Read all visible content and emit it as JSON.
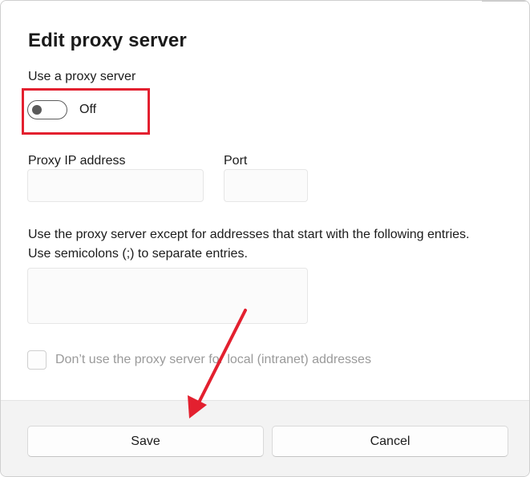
{
  "dialog": {
    "title": "Edit proxy server",
    "use_proxy_label": "Use a proxy server",
    "toggle": {
      "state_label": "Off",
      "on": false
    },
    "proxy_ip": {
      "label": "Proxy IP address",
      "value": "",
      "placeholder": ""
    },
    "port": {
      "label": "Port",
      "value": "",
      "placeholder": ""
    },
    "exceptions": {
      "line1": "Use the proxy server except for addresses that start with the following entries.",
      "line2": "Use semicolons (;) to separate entries.",
      "value": ""
    },
    "local_bypass": {
      "label": "Don’t use the proxy server for local (intranet) addresses",
      "checked": false,
      "disabled": true
    },
    "buttons": {
      "save": "Save",
      "cancel": "Cancel"
    }
  },
  "annotations": {
    "highlight_color": "#e3202f",
    "arrow_color": "#e3202f"
  },
  "colors": {
    "footer_bg": "#f3f3f3",
    "disabled_text": "#9a9a9a"
  },
  "icons": {
    "toggle_knob": "toggle-knob",
    "arrow": "annotation-arrow"
  }
}
